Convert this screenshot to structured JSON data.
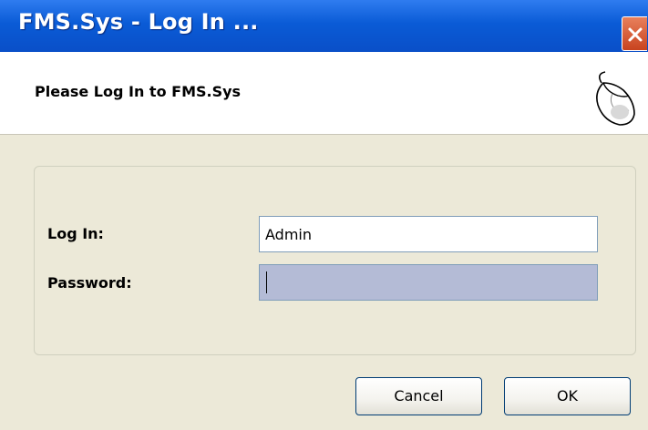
{
  "window": {
    "title": "FMS.Sys - Log In ..."
  },
  "header": {
    "title": "Please Log In to FMS.Sys",
    "icon": "mouse-icon"
  },
  "form": {
    "login_label": "Log In:",
    "login_value": "Admin",
    "password_label": "Password:",
    "password_value": ""
  },
  "buttons": {
    "cancel": "Cancel",
    "ok": "OK"
  },
  "colors": {
    "titlebar": "#0a5bd6",
    "focused_input": "#b4bbd6",
    "close_button": "#d9552f"
  }
}
